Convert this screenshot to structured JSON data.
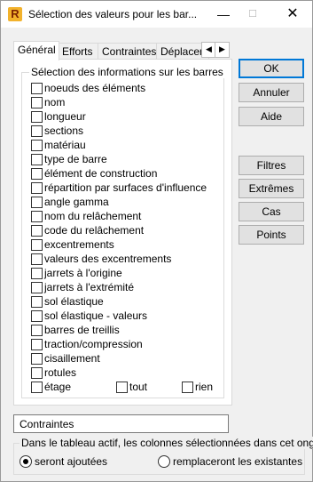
{
  "window": {
    "title": "Sélection des valeurs pour les bar...",
    "app_icon_letter": "R"
  },
  "titlebar_buttons": {
    "minimize": "—",
    "maximize": "☐",
    "close": "✕"
  },
  "tabs": [
    {
      "label": "Général",
      "active": true
    },
    {
      "label": "Efforts",
      "active": false
    },
    {
      "label": "Contraintes",
      "active": false
    },
    {
      "label": "Déplacen",
      "active": false
    }
  ],
  "tab_scroll": {
    "left": "◀",
    "right": "▶"
  },
  "group": {
    "legend": "Sélection des informations sur les barres",
    "items": [
      {
        "label": "noeuds des éléments",
        "checked": false
      },
      {
        "label": "nom",
        "checked": false
      },
      {
        "label": "longueur",
        "checked": false
      },
      {
        "label": "sections",
        "checked": false
      },
      {
        "label": "matériau",
        "checked": false
      },
      {
        "label": "type de barre",
        "checked": false
      },
      {
        "label": "élément de construction",
        "checked": false
      },
      {
        "label": "répartition par surfaces d'influence",
        "checked": false
      },
      {
        "label": "angle gamma",
        "checked": false
      },
      {
        "label": "nom du relâchement",
        "checked": false
      },
      {
        "label": "code du relâchement",
        "checked": false
      },
      {
        "label": "excentrements",
        "checked": false
      },
      {
        "label": "valeurs des excentrements",
        "checked": false
      },
      {
        "label": "jarrets à l'origine",
        "checked": false
      },
      {
        "label": "jarrets à l'extrémité",
        "checked": false
      },
      {
        "label": "sol élastique",
        "checked": false
      },
      {
        "label": "sol élastique - valeurs",
        "checked": false
      },
      {
        "label": "barres de treillis",
        "checked": false
      },
      {
        "label": "traction/compression",
        "checked": false
      },
      {
        "label": "cisaillement",
        "checked": false
      },
      {
        "label": "rotules",
        "checked": false
      },
      {
        "label": "étage",
        "checked": false
      }
    ],
    "all_label": "tout",
    "none_label": "rien"
  },
  "buttons": {
    "ok": "OK",
    "cancel": "Annuler",
    "help": "Aide",
    "filters": "Filtres",
    "extremes": "Extrêmes",
    "cases": "Cas",
    "points": "Points"
  },
  "textbox": {
    "value": "Contraintes"
  },
  "bottom": {
    "legend": "Dans le tableau actif, les colonnes sélectionnées dans cet onglet",
    "option_add": "seront ajoutées",
    "option_replace": "remplaceront les existantes",
    "selected": "add"
  }
}
